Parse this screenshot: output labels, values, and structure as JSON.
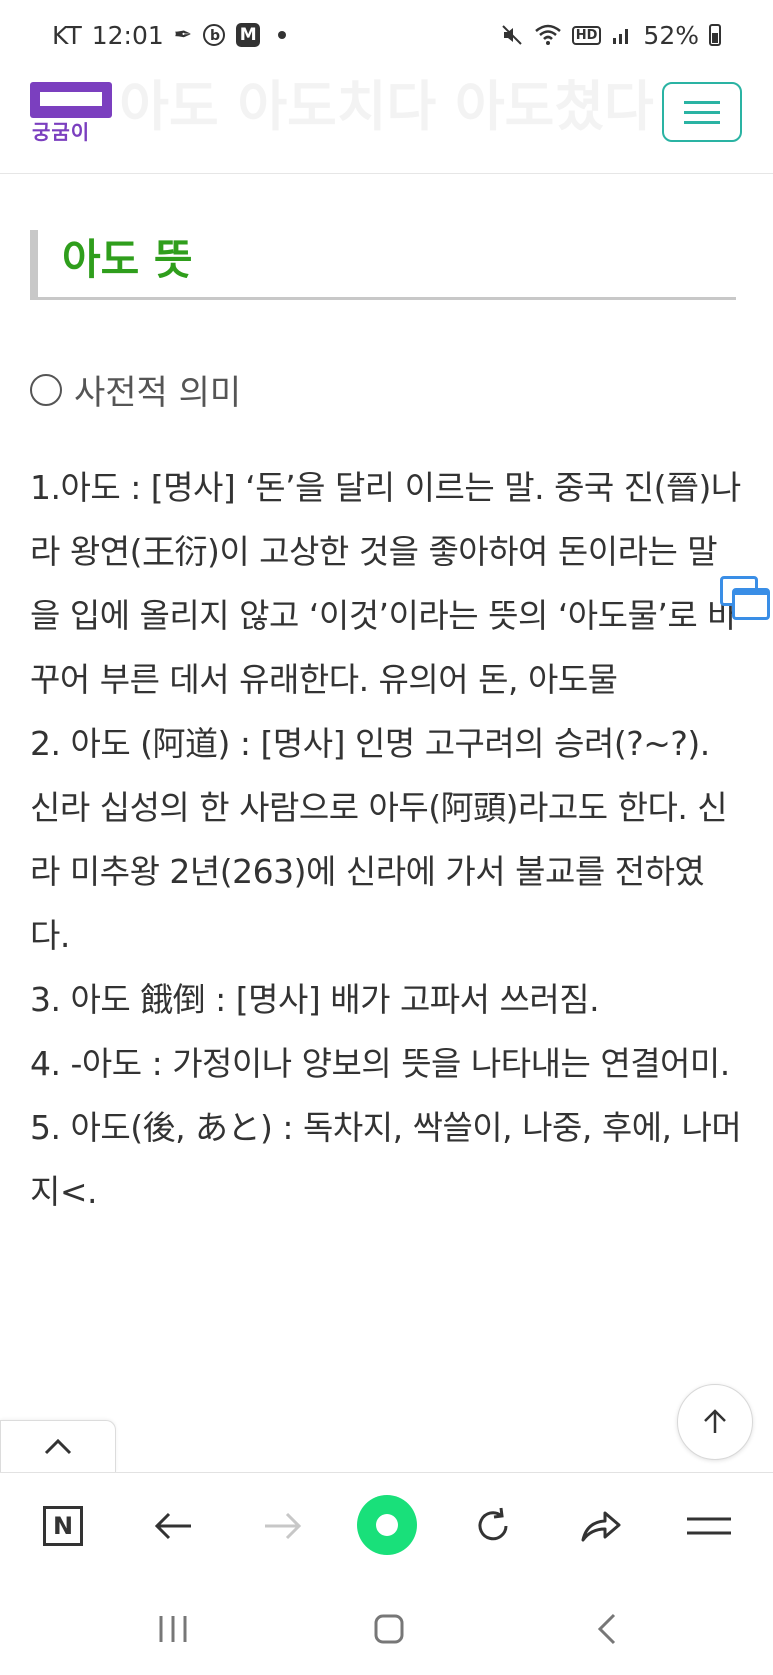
{
  "status_bar": {
    "carrier": "KT",
    "time": "12:01",
    "m_badge": "M",
    "hd_label": "HD",
    "battery_percent": "52%"
  },
  "header": {
    "ghost_title": "아도 아도치다 아도쳤다",
    "logo_text": "궁굼이",
    "brand_color": "#7b3fbf",
    "menu_color": "#2ab3a3"
  },
  "content": {
    "section_title": "아도 뜻",
    "section_title_color": "#2f9e1c",
    "sub_heading": "사전적 의미",
    "definitions": [
      "1.아도 : [명사] ‘돈’을 달리 이르는 말. 중국 진(晉)나라 왕연(王衍)이 고상한 것을 좋아하여 돈이라는 말을 입에 올리지 않고 ‘이것’이라는 뜻의 ‘아도물’로 바꾸어 부른 데서 유래한다. 유의어 돈, 아도물",
      "2. 아도 (阿道) : [명사] 인명 고구려의 승려(?~?). 신라 십성의 한 사람으로 아두(阿頭)라고도 한다. 신라 미추왕 2년(263)에 신라에 가서 불교를 전하였다.",
      "3. 아도 餓倒 : [명사] 배가 고파서 쓰러짐.",
      "4. -아도 : 가정이나 양보의 뜻을 나타내는 연결어미.",
      "5. 아도(後, あと) : 독차지, 싹쓸이, 나중, 후에, 나머지<."
    ]
  },
  "browser_bar": {
    "n_label": "N",
    "accent_color": "#19e07a"
  }
}
